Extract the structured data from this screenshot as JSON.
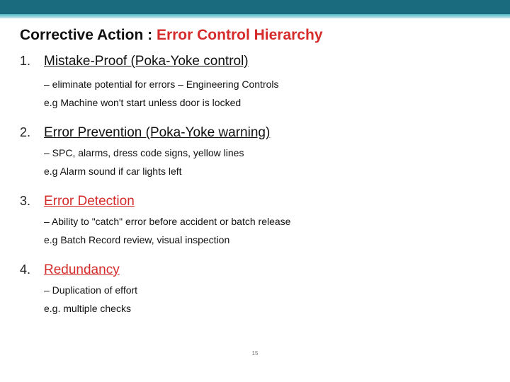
{
  "title_part1": "Corrective  Action : ",
  "title_part2": "Error Control Hierarchy",
  "items": [
    {
      "heading": "Mistake-Proof (Poka-Yoke control)",
      "heading_red": false,
      "desc": "– eliminate potential for errors – Engineering Controls",
      "example": "e.g Machine won't start unless door is locked",
      "tight": false
    },
    {
      "heading": "Error Prevention (Poka-Yoke warning)",
      "heading_red": false,
      "desc": "– SPC, alarms, dress code signs, yellow lines",
      "example": "e.g Alarm sound if car lights left",
      "tight": true
    },
    {
      "heading": "Error Detection",
      "heading_red": true,
      "desc": "– Ability to \"catch\" error before accident or batch release",
      "example": "e.g Batch Record review, visual inspection",
      "tight": true
    },
    {
      "heading": "Redundancy",
      "heading_red": true,
      "desc": "– Duplication of effort",
      "example": "e.g. multiple checks",
      "tight": true
    }
  ],
  "page_number": "15"
}
